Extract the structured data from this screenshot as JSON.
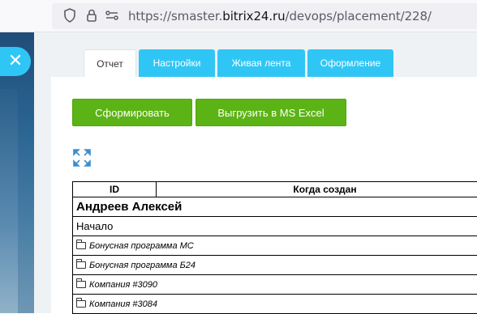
{
  "browser": {
    "url_prefix": "https://smaster.",
    "url_domain": "bitrix24.ru",
    "url_path": "/devops/placement/228/"
  },
  "slider": {
    "close_icon": "close-icon"
  },
  "tabs": [
    {
      "label": "Отчет",
      "active": true
    },
    {
      "label": "Настройки",
      "active": false
    },
    {
      "label": "Живая лента",
      "active": false
    },
    {
      "label": "Оформление",
      "active": false
    }
  ],
  "toolbar": {
    "generate_label": "Сформировать",
    "export_label": "Выгрузить в MS Excel",
    "expand_icon": "expand-icon"
  },
  "table": {
    "headers": [
      "ID",
      "Когда создан"
    ],
    "person": "Андреев Алексей",
    "start": "Начало",
    "folders": [
      "Бонусная программа МС",
      "Бонусная программа Б24",
      "Компания #3090",
      "Компания #3084"
    ]
  },
  "colors": {
    "tab_accent": "#2fc6f6",
    "button_green": "#5cb315"
  }
}
